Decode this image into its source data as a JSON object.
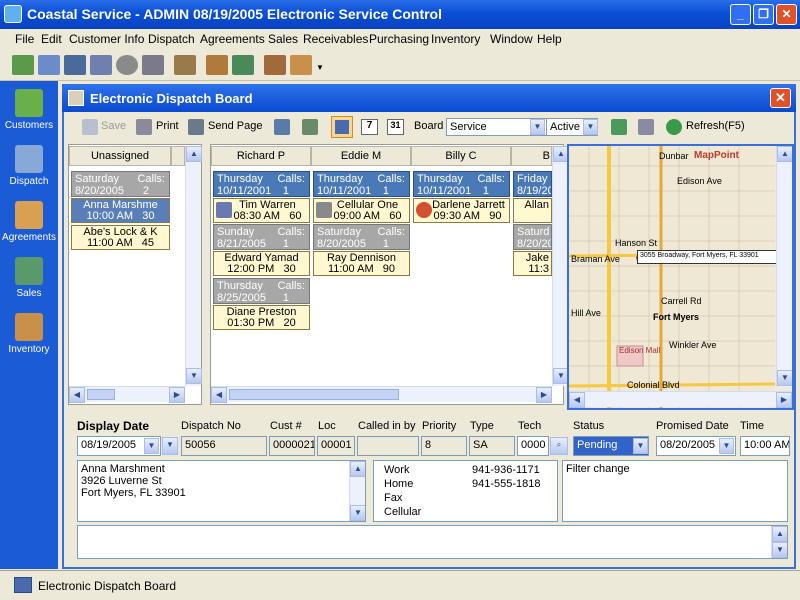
{
  "app": {
    "title": "Coastal Service - ADMIN 08/19/2005 Electronic Service Control"
  },
  "menu": [
    "File",
    "Edit",
    "Customer Info",
    "Dispatch",
    "Agreements",
    "Sales",
    "Receivables",
    "Purchasing",
    "Inventory",
    "Window",
    "Help"
  ],
  "nav": [
    {
      "label": "Customers"
    },
    {
      "label": "Dispatch"
    },
    {
      "label": "Agreements"
    },
    {
      "label": "Sales"
    },
    {
      "label": "Inventory"
    }
  ],
  "window": {
    "title": "Electronic Dispatch Board"
  },
  "toolbar": {
    "save": "Save",
    "print": "Print",
    "send_page": "Send Page",
    "board_label": "Board",
    "board_value": "Service",
    "status_value": "Active",
    "refresh": "Refresh(F5)",
    "cal7": "7",
    "cal31": "31"
  },
  "columns": {
    "unassigned": "Unassigned",
    "techs": [
      "Richard P",
      "Eddie M",
      "Billy C",
      "B"
    ]
  },
  "unassigned": {
    "days": [
      {
        "day": "Saturday",
        "date": "8/20/2005",
        "calls_label": "Calls:",
        "calls": "2"
      }
    ],
    "appts": [
      {
        "name": "Anna Marshme",
        "time": "10:00 AM",
        "dur": "30"
      },
      {
        "name": "Abe's Lock & K",
        "time": "11:00 AM",
        "dur": "45"
      }
    ]
  },
  "tech_cols": [
    {
      "blocks": [
        {
          "day": "Thursday",
          "date": "10/11/2001",
          "calls_label": "Calls:",
          "calls": "1",
          "appts": [
            {
              "name": "Tim Warren",
              "time": "08:30 AM",
              "dur": "60",
              "icon": "truck-icon"
            }
          ]
        },
        {
          "day": "Sunday",
          "date": "8/21/2005",
          "calls_label": "Calls:",
          "calls": "1",
          "appts": [
            {
              "name": "Edward Yamad",
              "time": "12:00 PM",
              "dur": "30"
            }
          ]
        },
        {
          "day": "Thursday",
          "date": "8/25/2005",
          "calls_label": "Calls:",
          "calls": "1",
          "appts": [
            {
              "name": "Diane Preston",
              "time": "01:30 PM",
              "dur": "20"
            }
          ]
        }
      ]
    },
    {
      "blocks": [
        {
          "day": "Thursday",
          "date": "10/11/2001",
          "calls_label": "Calls:",
          "calls": "1",
          "appts": [
            {
              "name": "Cellular One",
              "time": "09:00 AM",
              "dur": "60",
              "icon": "tools-icon"
            }
          ]
        },
        {
          "day": "Saturday",
          "date": "8/20/2005",
          "calls_label": "Calls:",
          "calls": "1",
          "appts": [
            {
              "name": "Ray Dennison",
              "time": "11:00 AM",
              "dur": "90"
            }
          ]
        }
      ]
    },
    {
      "blocks": [
        {
          "day": "Thursday",
          "date": "10/11/2001",
          "calls_label": "Calls:",
          "calls": "1",
          "appts": [
            {
              "name": "Darlene Jarrett",
              "time": "09:30 AM",
              "dur": "90",
              "icon": "alarm-clock-icon"
            }
          ]
        }
      ]
    },
    {
      "blocks": [
        {
          "day": "Friday",
          "date": "8/19/20",
          "appts": [
            {
              "name": "Allan",
              "time": ""
            }
          ]
        },
        {
          "day": "Saturd",
          "date": "8/20/20",
          "appts": [
            {
              "name": "Jake",
              "time": "11:3"
            }
          ]
        }
      ]
    }
  ],
  "map": {
    "brand": "MapPoint",
    "address": "3055 Broadway, Fort Myers, FL 33901",
    "labels": [
      "Dunbar",
      "Edison Ave",
      "Hanson St",
      "Carrell Rd",
      "Fort Myers",
      "Winkler Ave",
      "Colonial Blvd",
      "Edison Mall",
      "Braman Ave",
      "Hill Ave"
    ]
  },
  "detail": {
    "labels": {
      "display_date": "Display Date",
      "dispatch_no": "Dispatch No",
      "cust": "Cust #",
      "loc": "Loc",
      "called_in_by": "Called in by",
      "priority": "Priority",
      "type": "Type",
      "tech": "Tech",
      "status": "Status",
      "promised_date": "Promised Date",
      "time": "Time"
    },
    "values": {
      "display_date": "08/19/2005",
      "dispatch_no": "50056",
      "cust": "0000021",
      "loc": "00001",
      "called_in_by": "",
      "priority": "8",
      "type": "SA",
      "tech": "0000",
      "status": "Pending",
      "promised_date": "08/20/2005",
      "time": "10:00 AM"
    },
    "address": [
      "Anna Marshment",
      "3926 Luverne St",
      "Fort Myers, FL  33901"
    ],
    "phones": [
      {
        "label": "Work",
        "value": "941-936-1171"
      },
      {
        "label": "Home",
        "value": "941-555-1818"
      },
      {
        "label": "Fax",
        "value": ""
      },
      {
        "label": "Cellular",
        "value": ""
      }
    ],
    "notes": "Filter change"
  },
  "statusbar": {
    "task": "Electronic Dispatch Board"
  }
}
